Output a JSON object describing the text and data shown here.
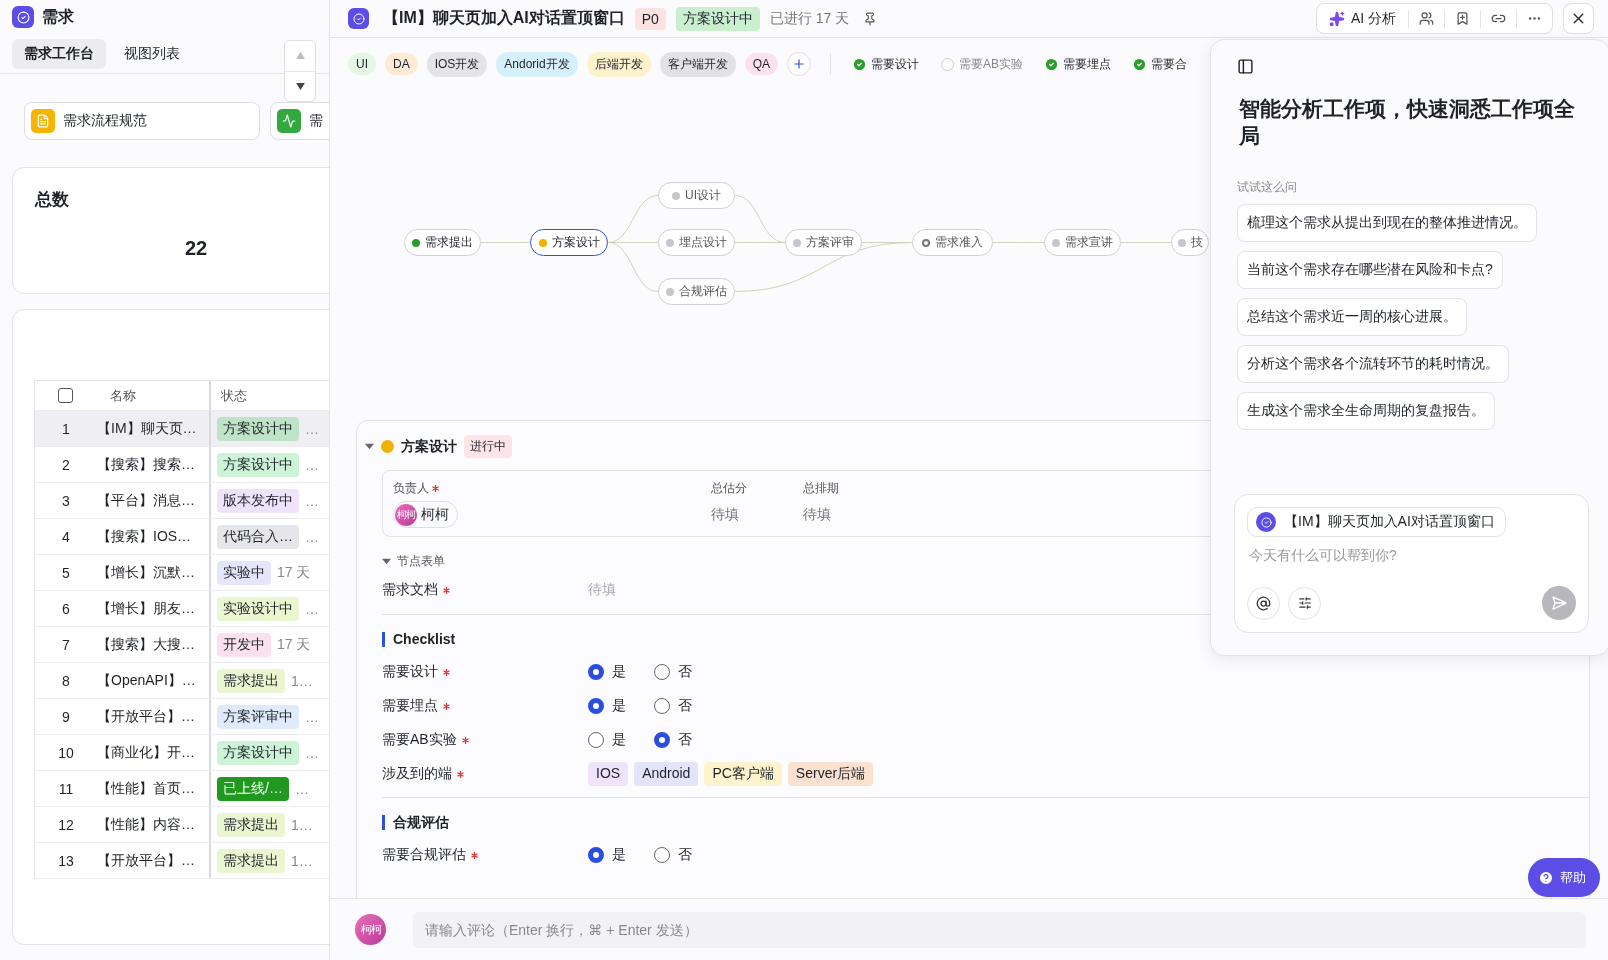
{
  "sidebar": {
    "title": "需求",
    "tabs": [
      {
        "label": "需求工作台",
        "selected": true
      },
      {
        "label": "视图列表",
        "selected": false
      }
    ],
    "shortcuts": [
      {
        "label": "需求流程规范",
        "kind": "doc",
        "color": "#f5b500"
      },
      {
        "label": "需",
        "kind": "chart",
        "color": "#32a83f"
      }
    ],
    "total": {
      "label": "总数",
      "value": "22"
    },
    "table": {
      "all_checked": false,
      "columns": [
        "名称",
        "状态"
      ],
      "rows": [
        {
          "index": "1",
          "name": "【IM】聊天页…",
          "status": "方案设计中",
          "color": "#bfe3c6",
          "extra": "…",
          "selected": true
        },
        {
          "index": "2",
          "name": "【搜索】搜索…",
          "status": "方案设计中",
          "color": "#cdf3d6",
          "extra": "…",
          "selected": false
        },
        {
          "index": "3",
          "name": "【平台】消息…",
          "status": "版本发布中",
          "color": "#efe3fb",
          "extra": "…",
          "selected": false
        },
        {
          "index": "4",
          "name": "【搜索】IOS…",
          "status": "代码合入…",
          "color": "#e6e6ea",
          "extra": "…",
          "selected": false
        },
        {
          "index": "5",
          "name": "【增长】沉默…",
          "status": "实验中",
          "color": "#e6e6fb",
          "extra": "17 天",
          "selected": false
        },
        {
          "index": "6",
          "name": "【增长】朋友…",
          "status": "实验设计中",
          "color": "#e9f6cf",
          "extra": "…",
          "selected": false
        },
        {
          "index": "7",
          "name": "【搜索】大搜…",
          "status": "开发中",
          "color": "#fbe1f0",
          "extra": "17 天",
          "selected": false
        },
        {
          "index": "8",
          "name": "【OpenAPI】…",
          "status": "需求提出",
          "color": "#e9f6cf",
          "extra": "1…",
          "selected": false
        },
        {
          "index": "9",
          "name": "【开放平台】…",
          "status": "方案评审中",
          "color": "#dfeafb",
          "extra": "…",
          "selected": false
        },
        {
          "index": "10",
          "name": "【商业化】开…",
          "status": "方案设计中",
          "color": "#cdf3d6",
          "extra": "…",
          "selected": false
        },
        {
          "index": "11",
          "name": "【性能】首页…",
          "status": "已上线/…",
          "color": "#1f9a1f",
          "extra": "…",
          "selected": false
        },
        {
          "index": "12",
          "name": "【性能】内容…",
          "status": "需求提出",
          "color": "#e9f6cf",
          "extra": "1…",
          "selected": false
        },
        {
          "index": "13",
          "name": "【开放平台】…",
          "status": "需求提出",
          "color": "#e9f6cf",
          "extra": "1…",
          "selected": false
        }
      ]
    }
  },
  "detail": {
    "title": "【IM】聊天页加入AI对话置顶窗口",
    "priority": "P0",
    "status": "方案设计中",
    "elapsed": "已进行 17 天",
    "ai_button": "AI 分析",
    "tags": [
      {
        "label": "UI",
        "color": "#e4f7e4"
      },
      {
        "label": "DA",
        "color": "#fdebd6"
      },
      {
        "label": "IOS开发",
        "color": "#e3e3e8"
      },
      {
        "label": "Andorid开发",
        "color": "#d5f0fb"
      },
      {
        "label": "后端开发",
        "color": "#fdf2cc"
      },
      {
        "label": "客户端开发",
        "color": "#e2e2e6"
      },
      {
        "label": "QA",
        "color": "#fbe2ee"
      }
    ],
    "checks": [
      {
        "label": "需要设计",
        "checked": true
      },
      {
        "label": "需要AB实验",
        "checked": false
      },
      {
        "label": "需要埋点",
        "checked": true
      },
      {
        "label": "需要合",
        "checked": true
      }
    ],
    "flow": [
      {
        "label": "需求提出",
        "kind": "done"
      },
      {
        "label": "方案设计",
        "kind": "current"
      },
      {
        "label": "UI设计",
        "kind": "pending"
      },
      {
        "label": "埋点设计",
        "kind": "pending"
      },
      {
        "label": "合规评估",
        "kind": "pending"
      },
      {
        "label": "方案评审",
        "kind": "pending"
      },
      {
        "label": "需求准入",
        "kind": "gate"
      },
      {
        "label": "需求宣讲",
        "kind": "pending"
      },
      {
        "label": "技",
        "kind": "pending"
      }
    ],
    "stage": {
      "title": "方案设计",
      "state": "进行中",
      "expanded": true,
      "color": "#f2b200",
      "fields": [
        {
          "label": "负责人",
          "required": true
        },
        {
          "label": "总估分",
          "required": false
        },
        {
          "label": "总排期",
          "required": false
        }
      ],
      "owner": {
        "avatar": "柯柯",
        "name": "柯柯"
      },
      "values": [
        "待填",
        "待填"
      ],
      "form": {
        "title": "节点表单",
        "expanded": true,
        "fields": [
          {
            "label": "需求文档",
            "required": true,
            "placeholder": "待填"
          }
        ]
      },
      "sections": [
        {
          "title": "Checklist",
          "items": [
            {
              "kind": "radio",
              "label": "需要设计",
              "required": true,
              "options": [
                {
                  "label": "是",
                  "selected": true
                },
                {
                  "label": "否",
                  "selected": false
                }
              ]
            },
            {
              "kind": "radio",
              "label": "需要埋点",
              "required": true,
              "options": [
                {
                  "label": "是",
                  "selected": true
                },
                {
                  "label": "否",
                  "selected": false
                }
              ]
            },
            {
              "kind": "radio",
              "label": "需要AB实验",
              "required": true,
              "options": [
                {
                  "label": "是",
                  "selected": false
                },
                {
                  "label": "否",
                  "selected": true
                }
              ]
            },
            {
              "kind": "tags",
              "label": "涉及到的端",
              "required": true,
              "tags": [
                {
                  "label": "IOS",
                  "color": "#efe3fb"
                },
                {
                  "label": "Android",
                  "color": "#e3e3fb"
                },
                {
                  "label": "PC客户端",
                  "color": "#fdf3cc"
                },
                {
                  "label": "Server后端",
                  "color": "#fbe1cf"
                }
              ]
            }
          ]
        },
        {
          "title": "合规评估",
          "items": [
            {
              "kind": "radio",
              "label": "需要合规评估",
              "required": true,
              "options": [
                {
                  "label": "是",
                  "selected": true
                },
                {
                  "label": "否",
                  "selected": false
                }
              ]
            }
          ]
        }
      ]
    },
    "comment": {
      "avatar": "柯柯",
      "placeholder": "请输入评论（Enter 换行，⌘ + Enter 发送）"
    },
    "help": "帮助"
  },
  "ai_panel": {
    "title": "智能分析工作项，快速洞悉工作项全局",
    "hint": "试试这么问",
    "suggestions": [
      "梳理这个需求从提出到现在的整体推进情况。",
      "当前这个需求存在哪些潜在风险和卡点?",
      "总结这个需求近一周的核心进展。",
      "分析这个需求各个流转环节的耗时情况。",
      "生成这个需求全生命周期的复盘报告。"
    ],
    "context": "【IM】聊天页加入AI对话置顶窗口",
    "placeholder": "今天有什么可以帮到你?",
    "send_disabled": true
  }
}
